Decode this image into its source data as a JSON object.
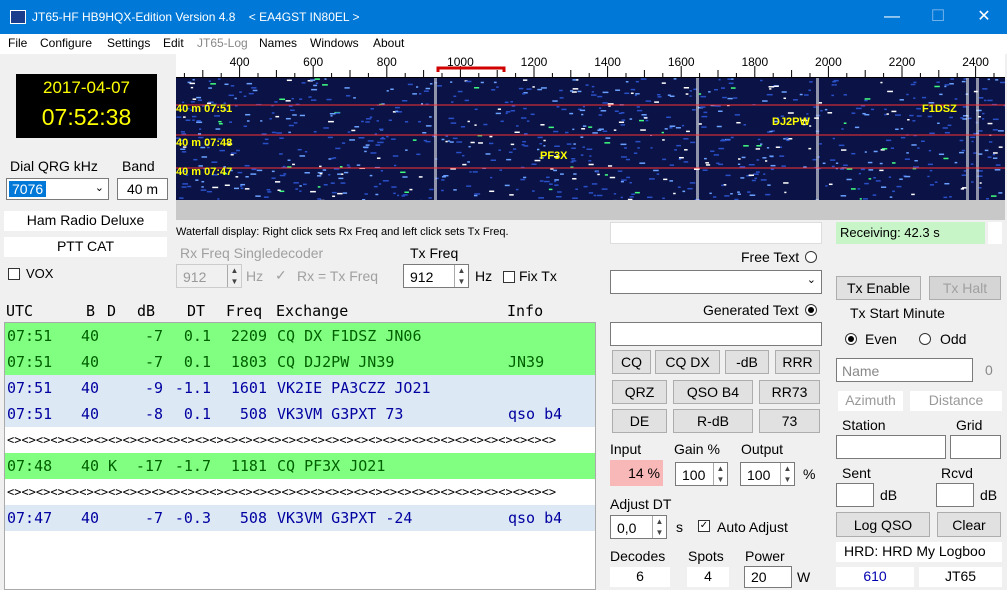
{
  "window": {
    "title": "JT65-HF HB9HQX-Edition Version 4.8    < EA4GST IN80EL >",
    "minimize": "—",
    "maximize": "☐",
    "close": "✕"
  },
  "menu": [
    "File",
    "Configure",
    "Settings",
    "Edit",
    "JT65-Log",
    "Names",
    "Windows",
    "About"
  ],
  "clock": {
    "date": "2017-04-07",
    "time": "07:52:38"
  },
  "dial": {
    "label": "Dial QRG kHz",
    "value": "7076",
    "band_label": "Band",
    "band_value": "40 m"
  },
  "radio": {
    "rig": "Ham Radio Deluxe",
    "ptt": "PTT CAT",
    "vox": "VOX"
  },
  "scale": {
    "labels": [
      "400",
      "600",
      "800",
      "1000",
      "1200",
      "1400",
      "1600",
      "1800",
      "2000",
      "2200",
      "2400"
    ]
  },
  "waterfall": {
    "lines": [
      "40 m 07:51",
      "40 m 07:48",
      "40 m 07:47"
    ],
    "calls": [
      "F1DSZ",
      "DJ2PW",
      "PF3X"
    ]
  },
  "hint": "Waterfall display: Right click sets Rx Freq and left click sets Tx Freq.",
  "rxfreq": {
    "label": "Rx Freq Singledecoder",
    "value": "912",
    "unit": "Hz",
    "rxeqtx": "Rx = Tx Freq"
  },
  "txfreq": {
    "label": "Tx Freq",
    "value": "912",
    "unit": "Hz",
    "fixtx": "Fix Tx"
  },
  "headers": {
    "utc": "UTC",
    "b": "B",
    "d": "D",
    "db": "dB",
    "dt": "DT",
    "freq": "Freq",
    "exchange": "Exchange",
    "info": "Info"
  },
  "decodes": [
    {
      "utc": "07:51",
      "b": "40",
      "d": "",
      "db": "-7",
      "dt": "0.1",
      "freq": "2209",
      "exchange": "CQ DX F1DSZ JN06",
      "info": "",
      "color": "#80ff80",
      "ink": "#006000"
    },
    {
      "utc": "07:51",
      "b": "40",
      "d": "",
      "db": "-7",
      "dt": "0.1",
      "freq": "1803",
      "exchange": "CQ DJ2PW JN39",
      "info": "JN39",
      "color": "#80ff80",
      "ink": "#006000"
    },
    {
      "utc": "07:51",
      "b": "40",
      "d": "",
      "db": "-9",
      "dt": "-1.1",
      "freq": "1601",
      "exchange": "VK2IE PA3CZZ JO21",
      "info": "",
      "color": "#dde8f5",
      "ink": "#0000a0"
    },
    {
      "utc": "07:51",
      "b": "40",
      "d": "",
      "db": "-8",
      "dt": "0.1",
      "freq": "508",
      "exchange": "VK3VM G3PXT 73",
      "info": "qso b4",
      "color": "#dde8f5",
      "ink": "#0000a0"
    },
    {
      "sep": "<><><><><><><><><><><><><><><><><><><><><><><><><><><><><><><><><><><><><><>"
    },
    {
      "utc": "07:48",
      "b": "40",
      "d": "K",
      "db": "-17",
      "dt": "-1.7",
      "freq": "1181",
      "exchange": "CQ PF3X JO21",
      "info": "",
      "color": "#80ff80",
      "ink": "#006000"
    },
    {
      "sep": "<><><><><><><><><><><><><><><><><><><><><><><><><><><><><><><><><><><><><><>"
    },
    {
      "utc": "07:47",
      "b": "40",
      "d": "",
      "db": "-7",
      "dt": "-0.3",
      "freq": "508",
      "exchange": "VK3VM G3PXT -24",
      "info": "qso b4",
      "color": "#dde8f5",
      "ink": "#0000a0"
    }
  ],
  "freetext": {
    "label": "Free Text",
    "value": ""
  },
  "gentext": {
    "label": "Generated Text",
    "value": ""
  },
  "msgbtns": [
    "CQ",
    "CQ DX",
    "-dB",
    "RRR",
    "QRZ",
    "QSO B4",
    "RR73",
    "DE",
    "R-dB",
    "73"
  ],
  "levels": {
    "input_label": "Input",
    "input_value": "14 %",
    "gain_label": "Gain %",
    "gain_value": "100",
    "output_label": "Output",
    "output_value": "100",
    "output_unit": "%"
  },
  "adjust": {
    "label": "Adjust DT",
    "value": "0,0",
    "unit": "s",
    "auto": "Auto Adjust"
  },
  "stats": {
    "decodes_label": "Decodes",
    "decodes": "6",
    "spots_label": "Spots",
    "spots": "4",
    "power_label": "Power",
    "power": "20",
    "power_unit": "W"
  },
  "right": {
    "status": "Receiving: 42.3 s",
    "txenable": "Tx Enable",
    "txhalt": "Tx Halt",
    "startmin": "Tx Start Minute",
    "even": "Even",
    "odd": "Odd",
    "name_ph": "Name",
    "name_count": "0",
    "azimuth": "Azimuth",
    "distance": "Distance",
    "station": "Station",
    "grid": "Grid",
    "sent": "Sent",
    "rcvd": "Rcvd",
    "db": "dB",
    "logqso": "Log QSO",
    "clear": "Clear",
    "hrd": "HRD: HRD My Logboo",
    "count": "610",
    "mode": "JT65"
  },
  "colors": {
    "titlebar": "#0078d7",
    "cq_row": "#80ff80",
    "other_row": "#dde8f5",
    "clock_fg": "#ffff00",
    "status_bg": "#c8f5c8",
    "input_bg": "#f8b8b8"
  }
}
